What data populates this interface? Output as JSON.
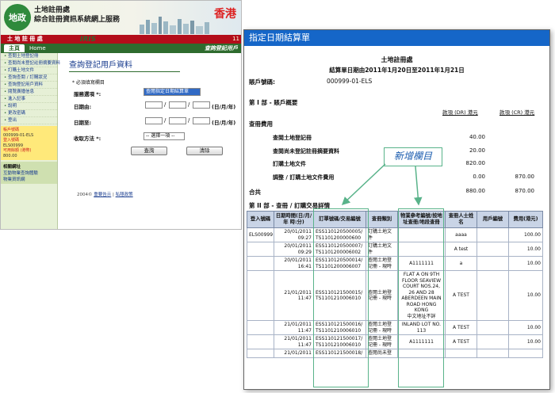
{
  "back_window": {
    "logo_text": "地政",
    "org_name_line1": "土地註冊處",
    "org_name_line2": "綜合註冊資訊系統網上服務",
    "hong_kong": "香港",
    "red_bar_title": "土 地 註 冊 處",
    "red_bar_num": "11",
    "iris_logo": "IRIS",
    "tabs": [
      "主頁",
      "Home"
    ],
    "tab_title": "查詢登記用戶",
    "sidebar_menu": [
      "查閱土地登記冊",
      "查閱尚未登記註冊摘要資料",
      "訂購土地文件",
      "查詢查閱 / 訂購狀況",
      "查詢登記用戶資料",
      "閱覽廣播信息",
      "進入記事",
      "說明",
      "更改密碼",
      "登出"
    ],
    "account_info": {
      "label": "帳戶號碼",
      "account": "000999-01-ELS",
      "login_label": "登入號碼",
      "login": "ELS00999",
      "balance_label": "可用餘額 (港幣)",
      "balance": "800.00"
    },
    "help": {
      "title": "相關網址",
      "links": [
        "互動物業查詢體驗",
        "物業資訊網"
      ]
    },
    "content": {
      "title": "查詢登記用戶資料",
      "required_note": "* 必須填寫欄目",
      "service_label": "服務選項 *:",
      "service_value": "查閱指定日期結算單",
      "date_from_label": "日期由:",
      "date_to_label": "日期至:",
      "date_hint": "(日/月/年)",
      "delivery_label": "收取方法 *:",
      "delivery_value": "-- 選擇一項 --",
      "query_button": "查詢",
      "clear_button": "清除"
    },
    "footer": {
      "copyright": "2004©",
      "link1": "重要告示",
      "link2": "私隱政策"
    }
  },
  "front_window": {
    "title": "指定日期結算單",
    "org": "土地註冊處",
    "subtitle": "結算單日期由2011年1月20日至2011年1月21日",
    "account_label": "賬戶號碼:",
    "account_value": "000999-01-ELS",
    "part1_title": "第 I 部 - 賬戶概要",
    "col_dr": "款項 (DR) 港元",
    "col_cr": "款項 (CR) 港元",
    "fees_title": "查冊費用",
    "fees": [
      {
        "label": "查閱土地登記冊",
        "dr": "40.00",
        "cr": ""
      },
      {
        "label": "查閱尚未登記註冊摘要資料",
        "dr": "20.00",
        "cr": ""
      },
      {
        "label": "訂購土地文件",
        "dr": "820.00",
        "cr": ""
      },
      {
        "label": "調整 / 訂購土地文件費用",
        "dr": "0.00",
        "cr": "870.00"
      }
    ],
    "total": {
      "label": "合共",
      "dr": "880.00",
      "cr": "870.00"
    },
    "part2_title": "第 II 部 - 查冊 / 訂購交易詳情",
    "table_headers": [
      "登入號碼",
      "日期時間(日/月/年 時:分)",
      "訂單號碼/交易編號",
      "查冊類別",
      "物業參考編號/按地址查冊/地段查冊",
      "查冊人士姓名",
      "用戶編號",
      "費用(港元)"
    ],
    "rows": [
      [
        "ELS00999",
        "20/01/2011\n09:27",
        "ESS110120500005/\nTS1101200000600",
        "訂購土地文件",
        "",
        "aaaa",
        "",
        "100.00"
      ],
      [
        "",
        "20/01/2011\n09:29",
        "ESS110120500007/\nTS1101200006002",
        "訂購土地文件",
        "",
        "A test",
        "",
        "10.00"
      ],
      [
        "",
        "20/01/2011\n16:41",
        "ESS110120500014/\nTS1101200006007",
        "查閱土地登記冊 - 現時",
        "A1111111",
        "a",
        "",
        "10.00"
      ],
      [
        "",
        "21/01/2011\n11:47",
        "ESS110121500015/\nTS1101210006010",
        "查閱土地登記冊 - 現時",
        "FLAT A ON 9TH FLOOR SEAVIEW COURT NOS.24, 26 AND 28 ABERDEEN MAIN ROAD HONG KONG\n中文地址不詳",
        "A TEST",
        "",
        "10.00"
      ],
      [
        "",
        "21/01/2011\n11:47",
        "ESS110121500016/\nTS1101210006010",
        "查閱土地登記冊 - 現時",
        "INLAND LOT NO. 113",
        "A TEST",
        "",
        "10.00"
      ],
      [
        "",
        "21/01/2011\n11:47",
        "ESS110121500017/\nTS1101210006010",
        "查閱土地登記冊 - 現時",
        "A1111111",
        "A TEST",
        "",
        "10.00"
      ],
      [
        "",
        "21/01/2011",
        "ESS110121500018/",
        "查閱尚未登",
        "",
        "",
        "",
        ""
      ]
    ]
  },
  "annotation": {
    "callout_text": "新增欄目",
    "color": "#59b38a"
  }
}
